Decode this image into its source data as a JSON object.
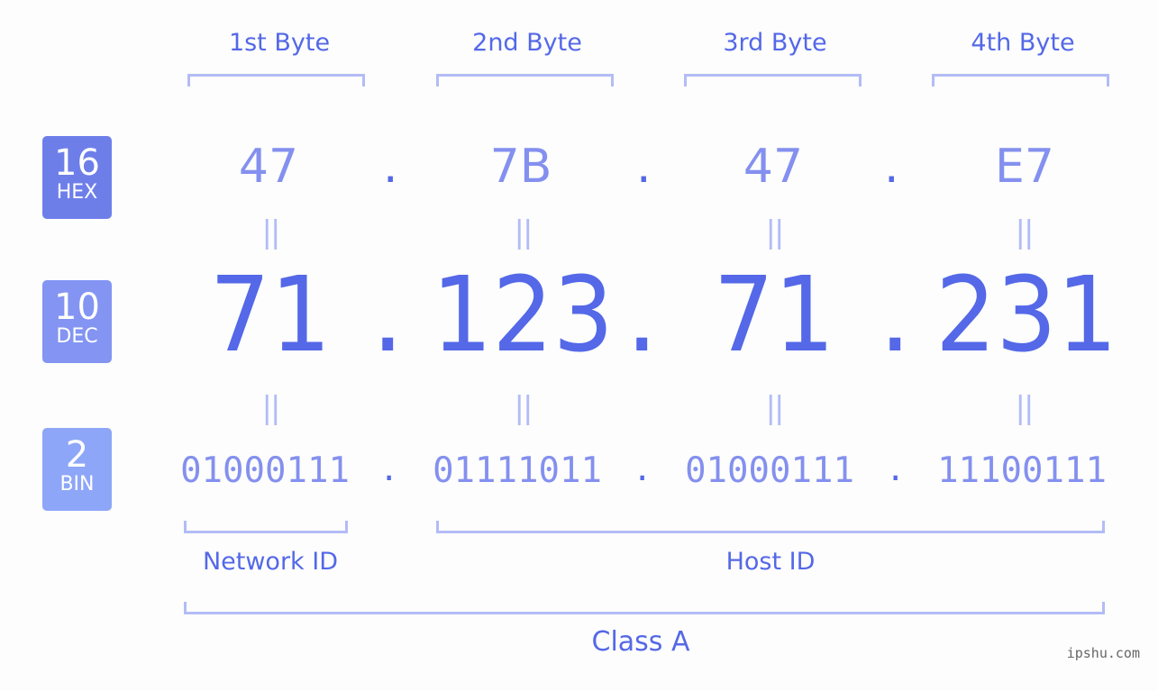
{
  "bytes": [
    {
      "label": "1st Byte",
      "hex": "47",
      "dec": "71",
      "bin": "01000111"
    },
    {
      "label": "2nd Byte",
      "hex": "7B",
      "dec": "123",
      "bin": "01111011"
    },
    {
      "label": "3rd Byte",
      "hex": "47",
      "dec": "71",
      "bin": "01000111"
    },
    {
      "label": "4th Byte",
      "hex": "E7",
      "dec": "231",
      "bin": "11100111"
    }
  ],
  "badges": {
    "hex": {
      "num": "16",
      "label": "HEX",
      "color": "#6e7ee9"
    },
    "dec": {
      "num": "10",
      "label": "DEC",
      "color": "#8394f2"
    },
    "bin": {
      "num": "2",
      "label": "BIN",
      "color": "#8da6f8"
    }
  },
  "separator": ".",
  "equals": "||",
  "network_label": "Network ID",
  "host_label": "Host ID",
  "class_label": "Class A",
  "watermark": "ipshu.com",
  "colors": {
    "accent": "#5468e8",
    "light": "#8490ef",
    "bracket": "#b3bcf6"
  }
}
